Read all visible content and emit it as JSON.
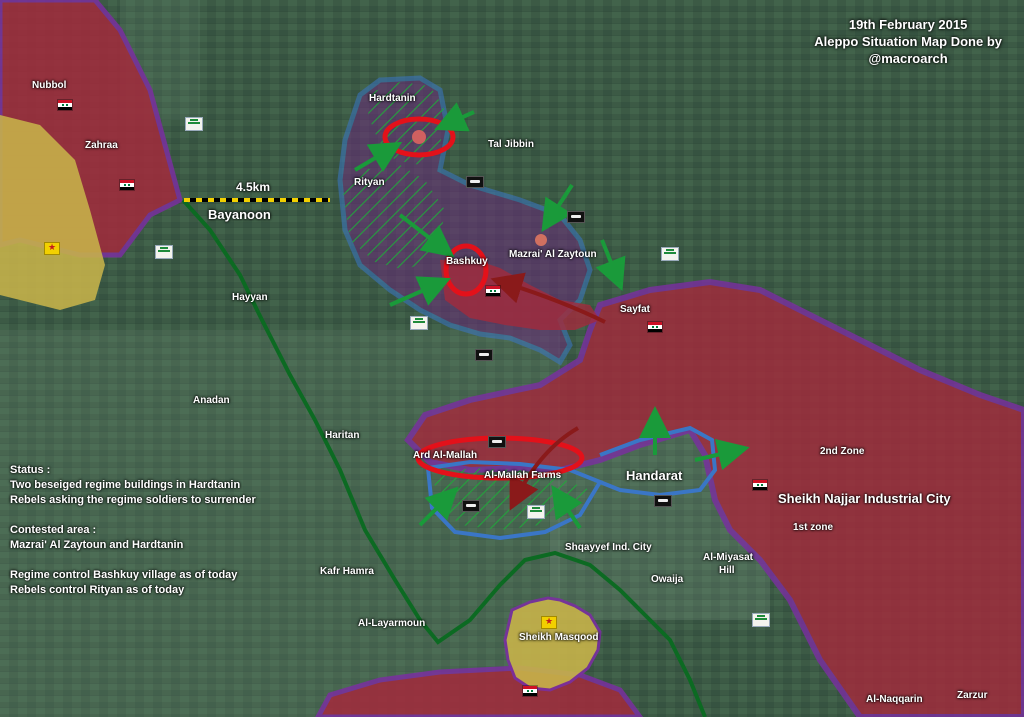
{
  "title": {
    "line1": "19th February 2015",
    "line2": "Aleppo Situation Map Done by",
    "line3": "@macroarch"
  },
  "distance_label": "4.5km",
  "status": {
    "l1": "Status :",
    "l2": "Two beseiged regime buildings in Hardtanin",
    "l3": "Rebels asking the regime soldiers to surrender",
    "l4": "Contested area :",
    "l5": "Mazrai' Al Zaytoun and Hardtanin",
    "l6": "Regime control Bashkuy village as of today",
    "l7": "Rebels control Rityan as of today"
  },
  "places": {
    "nubbol": "Nubbol",
    "zahraa": "Zahraa",
    "bayanoon": "Bayanoon",
    "hardtanin": "Hardtanin",
    "tal_jibbin": "Tal Jibbin",
    "rityan": "Rityan",
    "mazrai": "Mazrai' Al Zaytoun",
    "bashkuy": "Bashkuy",
    "hayyan": "Hayyan",
    "sayfat": "Sayfat",
    "anadan": "Anadan",
    "haritan": "Haritan",
    "ard_mallah": "Ard Al-Mallah",
    "mallah_farms": "Al-Mallah Farms",
    "handarat": "Handarat",
    "zone2": "2nd Zone",
    "sheikh_najjar": "Sheikh Najjar Industrial City",
    "zone1": "1st zone",
    "shqayyef": "Shqayyef Ind. City",
    "miyasat1": "Al-Miyasat",
    "miyasat2": "Hill",
    "owaija": "Owaija",
    "kafr_hamra": "Kafr Hamra",
    "layarmoun": "Al-Layarmoun",
    "sheikh_masqood": "Sheikh Masqood",
    "naqqarin": "Al-Naqqarin",
    "zarzur": "Zarzur"
  },
  "colors": {
    "satellite": "#3c5a45",
    "regime": "#a32a3c",
    "regime_border": "#7a2fa0",
    "kurdish": "#c7b34a",
    "contested": "#6a2a7a",
    "contested_border": "#3a76c6",
    "rebel_line": "#0c6a22",
    "hatch": "#1faa3a",
    "red_arrow": "#8a1a1a",
    "green_arrow": "#1a9a3a",
    "circle": "#e3111a"
  },
  "icons": {
    "regime_marker": "syrian-flag-icon",
    "isis_marker": "black-flag-icon",
    "rebel_marker": "rebel-flag-icon",
    "kurdish_marker": "ypg-star-icon"
  }
}
